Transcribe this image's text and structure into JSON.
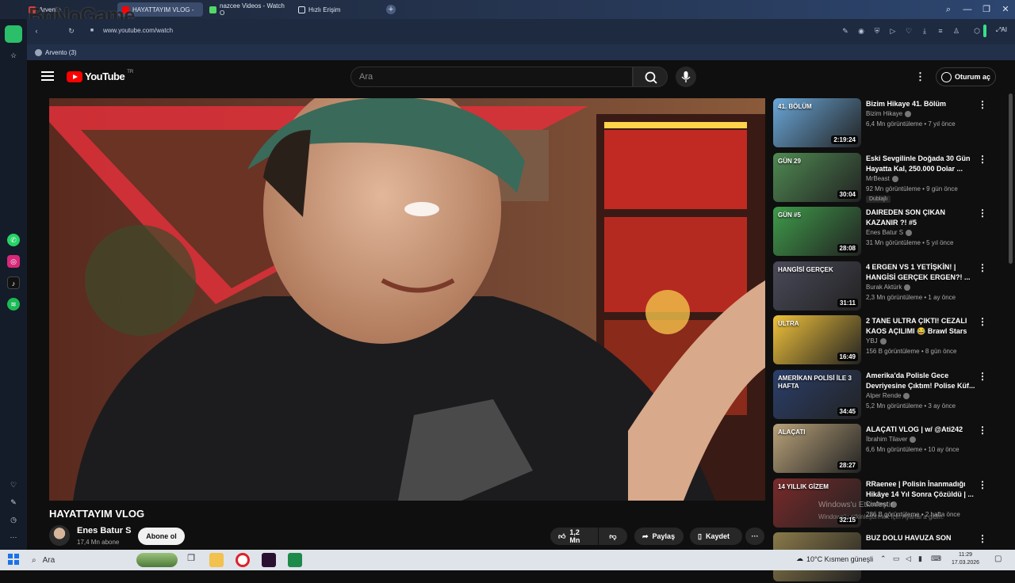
{
  "browser": {
    "tabs": [
      {
        "label": "Arvento"
      },
      {
        "label": "HAYATTAYIM VLOG -"
      },
      {
        "label": "nazcee Videos - Watch O"
      },
      {
        "label": "Hızlı Erişim"
      }
    ],
    "url": "www.youtube.com/watch",
    "bookmark": "Arvento (3)",
    "ai_label": "AI"
  },
  "watermark": "BgNoGame",
  "youtube": {
    "logo_text": "YouTube",
    "country": "TR",
    "search_placeholder": "Ara",
    "signin_label": "Oturum aç",
    "video": {
      "title": "HAYATTAYIM VLOG",
      "channel": "Enes Batur S",
      "subscribers": "17,4 Mn abone",
      "subscribe_label": "Abone ol",
      "likes": "1,2 Mn",
      "share_label": "Paylaş",
      "save_label": "Kaydet"
    },
    "recommendations": [
      {
        "title": "Bizim Hikaye 41. Bölüm",
        "channel": "Bizim Hikaye",
        "meta": "6,4 Mn görüntüleme • 7 yıl önce",
        "duration": "2:19:24",
        "thumb_text": "41. BÖLÜM",
        "color": "#6aa7d8"
      },
      {
        "title": "Eski Sevgilinle Doğada 30 Gün Hayatta Kal, 250.000 Dolar ...",
        "channel": "MrBeast",
        "meta": "92 Mn görüntüleme • 9 gün önce",
        "duration": "30:04",
        "badge": "Dublajlı",
        "thumb_text": "GÜN 29",
        "color": "#4f8a52"
      },
      {
        "title": "DAIREDEN SON ÇIKAN KAZANIR ?! #5",
        "channel": "Enes Batur S",
        "meta": "31 Mn görüntüleme • 5 yıl önce",
        "duration": "28:08",
        "thumb_text": "GÜN #5",
        "color": "#3f9b4a"
      },
      {
        "title": "4 ERGEN VS 1 YETİŞKİN! | HANGİSİ GERÇEK ERGEN?! ...",
        "channel": "Burak Aktürk",
        "meta": "2,3 Mn görüntüleme • 1 ay önce",
        "duration": "31:11",
        "thumb_text": "HANGİSİ GERÇEK",
        "color": "#4a4a5a"
      },
      {
        "title": "2 TANE ULTRA ÇIKTI! CEZALI KAOS AÇILIMI 😂 Brawl Stars",
        "channel": "YBJ",
        "meta": "156 B görüntüleme • 8 gün önce",
        "duration": "16:49",
        "thumb_text": "ULTRA",
        "color": "#f0c23a"
      },
      {
        "title": "Amerika'da Polisle Gece Devriyesine Çıktım! Polise Küf...",
        "channel": "Alper Rende",
        "meta": "5,2 Mn görüntüleme • 3 ay önce",
        "duration": "34:45",
        "thumb_text": "AMERİKAN POLİSİ İLE 3 HAFTA",
        "color": "#2b3f6b"
      },
      {
        "title": "ALAÇATI VLOG | w/ @Ati242",
        "channel": "İbrahim Tilaver",
        "meta": "6,6 Mn görüntüleme • 10 ay önce",
        "duration": "28:27",
        "thumb_text": "ALAÇATI",
        "color": "#b9a27a"
      },
      {
        "title": "RRaenee | Polisin İnanmadığı Hikâye 14 Yıl Sonra Çözüldü | ...",
        "channel": "Craftest",
        "meta": "286 B görüntüleme • 2 hafta önce",
        "duration": "32:15",
        "thumb_text": "14 YILLIK GİZEM",
        "color": "#7a2a2a"
      },
      {
        "title": "BUZ DOLU HAVUZA SON",
        "channel": "",
        "meta": "",
        "duration": "",
        "thumb_text": "",
        "color": "#8a7a4a"
      }
    ]
  },
  "activation": {
    "line1": "Windows'u Etkinleştir",
    "line2": "Windows'u etkinleştirmek için Ayarlar'a gidin."
  },
  "taskbar": {
    "search": "Ara",
    "weather": "10°C  Kısmen güneşli",
    "time": "11:29",
    "date": "17.03.2026"
  }
}
